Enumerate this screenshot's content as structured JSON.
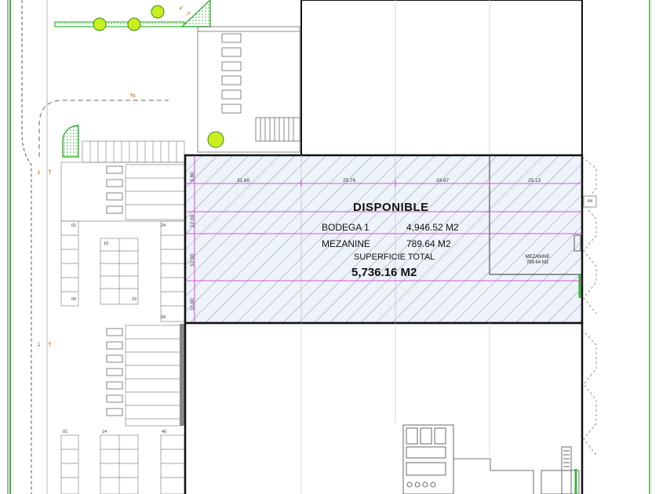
{
  "available_unit": {
    "status": "DISPONIBLE",
    "rows": [
      {
        "label": "BODEGA 1",
        "value": "4,946.52 M2"
      },
      {
        "label": "MEZANINE",
        "value": "789.64 M2"
      }
    ],
    "total_label": "SUPERFICIE TOTAL",
    "total_value": "5,736.16 M2"
  },
  "mezzanine_tag": {
    "label": "MEZANINE",
    "area": "789.64 M2"
  },
  "dimensions": {
    "horizontal": [
      "31.60",
      "25.76",
      "24.87",
      "25.13"
    ],
    "vertical": [
      "9.80",
      "12.00",
      "12.00",
      "11.90"
    ]
  },
  "parking_numbers": {
    "upper_left": [
      "01",
      "09"
    ],
    "upper_mid": [
      "10",
      "23"
    ],
    "upper_right": [
      "24",
      "34"
    ],
    "lower": [
      "01",
      "14",
      "40"
    ]
  },
  "side_label": "64",
  "colors": {
    "hatch": "#7a95b8",
    "hatch_fill": "#eef3f9",
    "dimension_line": "#d020c8",
    "green": "#3cb43c",
    "tree": "#c8ee20",
    "wall": "#111111",
    "loading_dock": "#e02020",
    "arrow": "#e07010"
  }
}
